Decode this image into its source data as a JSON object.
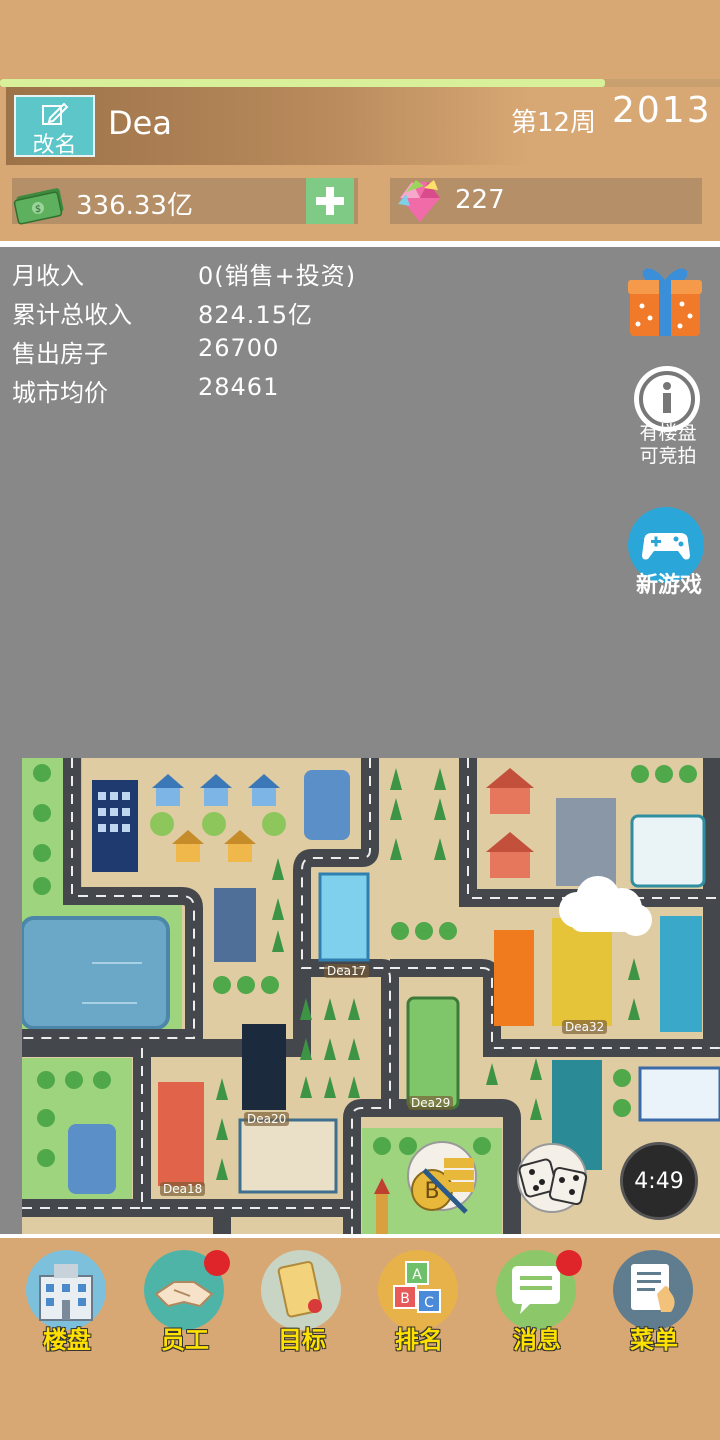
{
  "header": {
    "rename_label": "改名",
    "player_name": "Dea",
    "week": "第12周",
    "year": "2013",
    "week_progress": 0.84,
    "money": "336.33亿",
    "gems": "227"
  },
  "stats": [
    {
      "label": "月收入",
      "value": "0(销售+投资)"
    },
    {
      "label": "累计总收入",
      "value": "824.15亿"
    },
    {
      "label": "售出房子",
      "value": "26700"
    },
    {
      "label": "城市均价",
      "value": "28461"
    }
  ],
  "side_buttons": {
    "auction_line1": "有楼盘",
    "auction_line2": "可竞拍",
    "new_game": "新游戏"
  },
  "map": {
    "labels": [
      "Dea17",
      "Dea32",
      "Dea29",
      "Dea20",
      "Dea18"
    ]
  },
  "timer": "4:49",
  "nav": {
    "items": [
      {
        "label": "楼盘",
        "icon": "building-icon",
        "badge": false
      },
      {
        "label": "员工",
        "icon": "handshake-icon",
        "badge": true
      },
      {
        "label": "目标",
        "icon": "scroll-icon",
        "badge": false
      },
      {
        "label": "排名",
        "icon": "abc-blocks-icon",
        "badge": false
      },
      {
        "label": "消息",
        "icon": "message-icon",
        "badge": true
      },
      {
        "label": "菜单",
        "icon": "menu-hand-icon",
        "badge": false
      }
    ]
  },
  "colors": {
    "header_bg": "#D8A874",
    "body_bg": "#888888",
    "nav_label": "#FFE100",
    "badge": "#E0252A",
    "rename_button": "#5CC6C8"
  }
}
